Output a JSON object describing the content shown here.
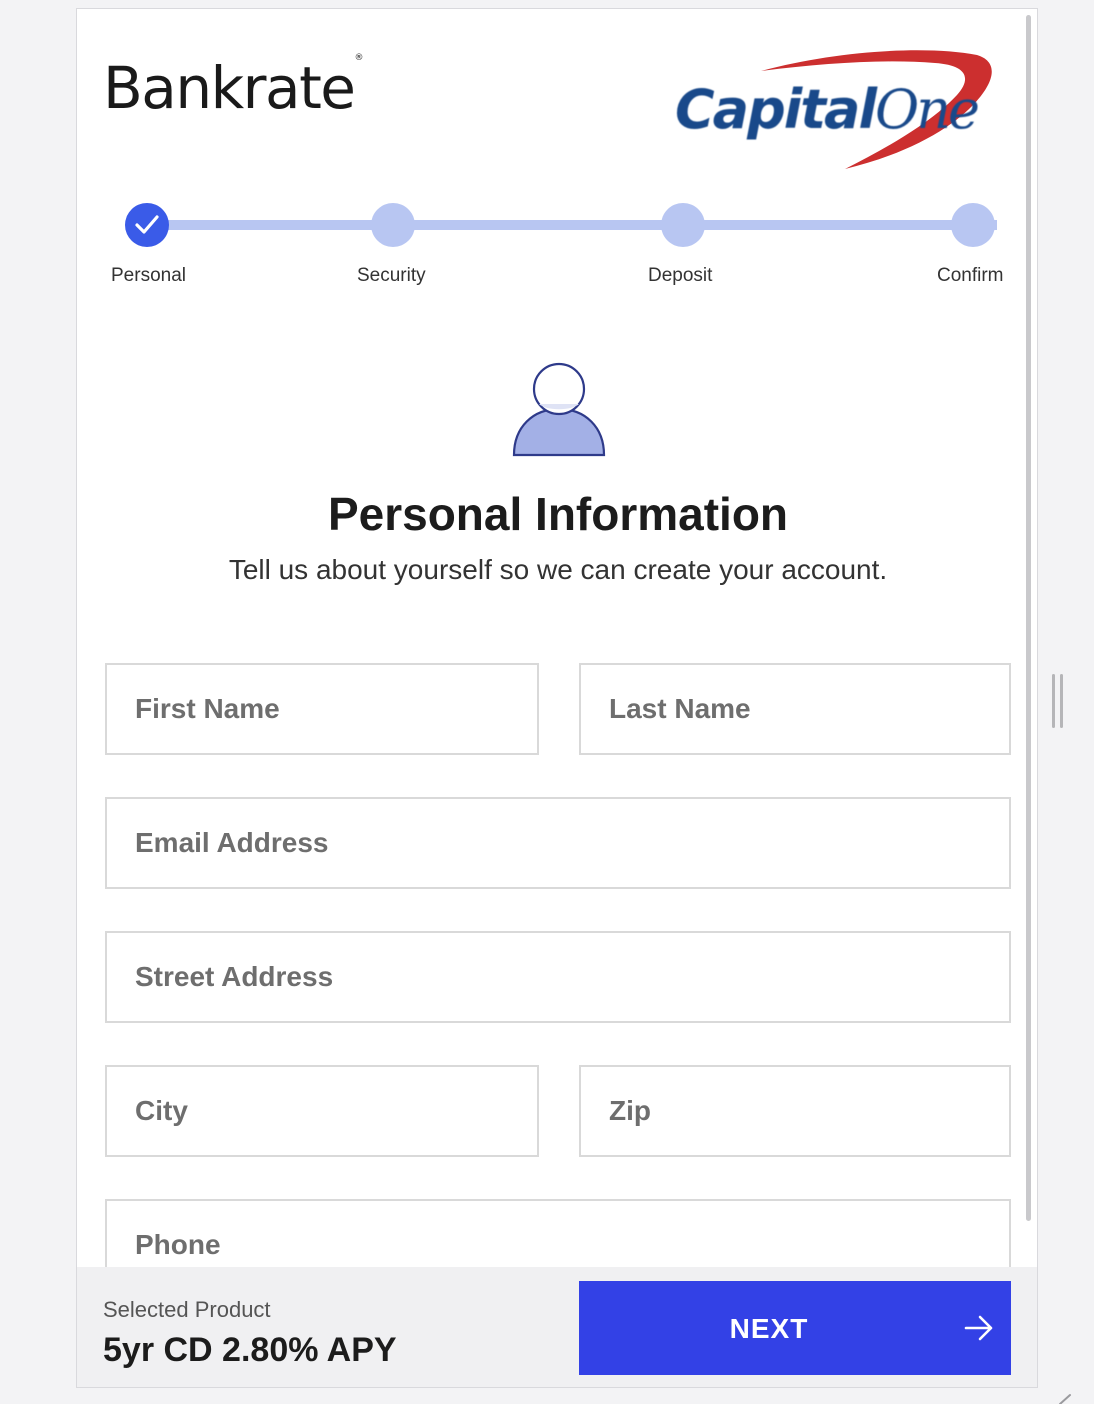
{
  "brand": {
    "bankrate_logo_text": "Bankrate",
    "bankrate_registered_mark": "®",
    "partner_logo_text_1": "Capital",
    "partner_logo_text_2": "One"
  },
  "stepper": {
    "steps": [
      {
        "label": "Personal",
        "state": "complete"
      },
      {
        "label": "Security",
        "state": "pending"
      },
      {
        "label": "Deposit",
        "state": "pending"
      },
      {
        "label": "Confirm",
        "state": "pending"
      }
    ],
    "current_step": 1
  },
  "header": {
    "avatar_icon": "user-avatar-icon",
    "title": "Personal Information",
    "subtitle": "Tell us about yourself so we can create your account."
  },
  "form": {
    "first_name": {
      "placeholder": "First Name",
      "value": ""
    },
    "last_name": {
      "placeholder": "Last Name",
      "value": ""
    },
    "email": {
      "placeholder": "Email Address",
      "value": ""
    },
    "street": {
      "placeholder": "Street Address",
      "value": ""
    },
    "city": {
      "placeholder": "City",
      "value": ""
    },
    "zip": {
      "placeholder": "Zip",
      "value": ""
    },
    "phone": {
      "placeholder": "Phone",
      "value": ""
    }
  },
  "footer": {
    "selected_product_label": "Selected Product",
    "selected_product_value": "5yr CD 2.80% APY",
    "next_label": "NEXT",
    "next_icon": "arrow-right-icon"
  },
  "colors": {
    "primary": "#3341e6",
    "step_complete": "#3a5be8",
    "step_pending": "#b8c6f2",
    "avatar_fill": "#a3b0e6",
    "capital_one_blue": "#19498a",
    "capital_one_red": "#cc2f2f"
  }
}
